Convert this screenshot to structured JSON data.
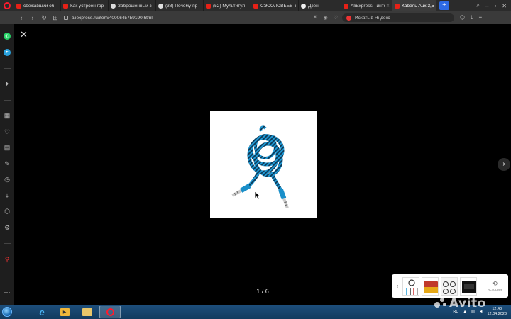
{
  "tabs": [
    {
      "label": "сбежавший об",
      "favicon_color": "#e62117",
      "active": false
    },
    {
      "label": "Как устроен гор",
      "favicon_color": "#e62117",
      "active": false
    },
    {
      "label": "Заброшенный з",
      "favicon_color": "#dddddd",
      "active": false
    },
    {
      "label": "(38) Почему пр",
      "favicon_color": "#dddddd",
      "active": false
    },
    {
      "label": "(52) Мультитул",
      "favicon_color": "#e62117",
      "active": false
    },
    {
      "label": "СЭСОЛОВЬЁВ-lr",
      "favicon_color": "#e62117",
      "active": false
    },
    {
      "label": "Дзен",
      "favicon_color": "#eeeeee",
      "active": false
    },
    {
      "label": "AliExpress - инте",
      "favicon_color": "#e62117",
      "active": false
    },
    {
      "label": "Кабель Aux 3,5",
      "favicon_color": "#e62117",
      "active": true
    }
  ],
  "new_tab_label": "+",
  "address_bar": {
    "url": "aliexpress.ru/item/4000645759190.html",
    "search_placeholder": "Искать в Яндекс"
  },
  "viewer": {
    "close_label": "✕",
    "counter": "1 / 6",
    "next_label": "›"
  },
  "thumbnails": {
    "prev_label": "‹",
    "history_label": "история"
  },
  "taskbar": {
    "language": "RU",
    "time": "12:40",
    "date": "12.04.2023"
  },
  "watermark": "Avito",
  "colors": {
    "opera_red": "#ff1b2d",
    "cable_blue": "#1f9ad6",
    "taskbar_blue": "#1d4f7c"
  }
}
